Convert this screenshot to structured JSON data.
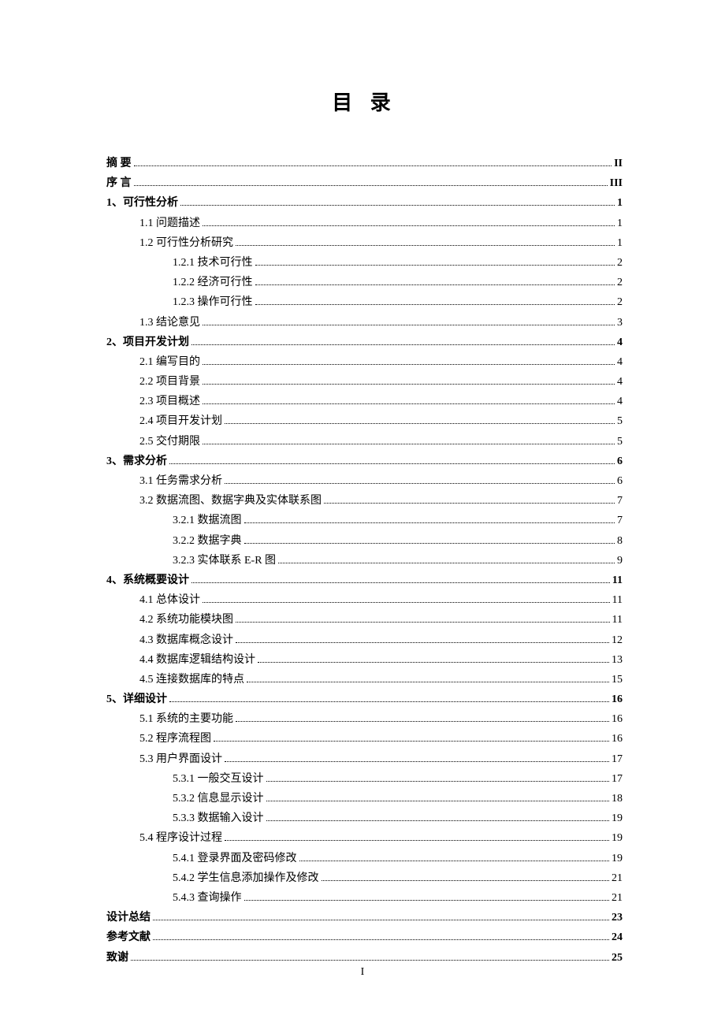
{
  "title": "目 录",
  "pageNumber": "I",
  "entries": [
    {
      "level": 0,
      "label": "摘   要",
      "page": "II"
    },
    {
      "level": 0,
      "label": "序   言",
      "page": "III"
    },
    {
      "level": 0,
      "label": "1、可行性分析",
      "page": "1"
    },
    {
      "level": 1,
      "label": "1.1 问题描述",
      "page": "1"
    },
    {
      "level": 1,
      "label": "1.2 可行性分析研究",
      "page": "1"
    },
    {
      "level": 2,
      "label": "1.2.1 技术可行性",
      "page": "2"
    },
    {
      "level": 2,
      "label": "1.2.2 经济可行性",
      "page": "2"
    },
    {
      "level": 2,
      "label": "1.2.3 操作可行性",
      "page": "2"
    },
    {
      "level": 1,
      "label": "1.3 结论意见",
      "page": "3"
    },
    {
      "level": 0,
      "label": "2、项目开发计划",
      "page": "4"
    },
    {
      "level": 1,
      "label": "2.1 编写目的",
      "page": "4"
    },
    {
      "level": 1,
      "label": "2.2 项目背景",
      "page": "4"
    },
    {
      "level": 1,
      "label": "2.3 项目概述",
      "page": "4"
    },
    {
      "level": 1,
      "label": "2.4 项目开发计划",
      "page": "5"
    },
    {
      "level": 1,
      "label": "2.5 交付期限",
      "page": "5"
    },
    {
      "level": 0,
      "label": "3、需求分析",
      "page": "6"
    },
    {
      "level": 1,
      "label": "3.1 任务需求分析",
      "page": "6"
    },
    {
      "level": 1,
      "label": "3.2 数据流图、数据字典及实体联系图",
      "page": "7"
    },
    {
      "level": 2,
      "label": "3.2.1 数据流图",
      "page": "7"
    },
    {
      "level": 2,
      "label": "3.2.2 数据字典",
      "page": "8"
    },
    {
      "level": 2,
      "label": "3.2.3 实体联系 E-R 图",
      "page": "9"
    },
    {
      "level": 0,
      "label": "4、系统概要设计",
      "page": "11"
    },
    {
      "level": 1,
      "label": "4.1 总体设计",
      "page": "11"
    },
    {
      "level": 1,
      "label": "4.2 系统功能模块图",
      "page": "11"
    },
    {
      "level": 1,
      "label": "4.3 数据库概念设计",
      "page": "12"
    },
    {
      "level": 1,
      "label": "4.4 数据库逻辑结构设计",
      "page": "13"
    },
    {
      "level": 1,
      "label": "4.5 连接数据库的特点",
      "page": "15"
    },
    {
      "level": 0,
      "label": "5、详细设计",
      "page": "16"
    },
    {
      "level": 1,
      "label": "5.1 系统的主要功能",
      "page": "16"
    },
    {
      "level": 1,
      "label": "5.2 程序流程图",
      "page": "16"
    },
    {
      "level": 1,
      "label": "5.3 用户界面设计",
      "page": "17"
    },
    {
      "level": 2,
      "label": "5.3.1 一般交互设计",
      "page": "17"
    },
    {
      "level": 2,
      "label": "5.3.2 信息显示设计",
      "page": "18"
    },
    {
      "level": 2,
      "label": "5.3.3 数据输入设计",
      "page": "19"
    },
    {
      "level": 1,
      "label": "5.4 程序设计过程",
      "page": "19"
    },
    {
      "level": 2,
      "label": "5.4.1 登录界面及密码修改",
      "page": "19"
    },
    {
      "level": 2,
      "label": "5.4.2 学生信息添加操作及修改",
      "page": "21"
    },
    {
      "level": 2,
      "label": "5.4.3 查询操作",
      "page": "21"
    },
    {
      "level": 0,
      "label": "设计总结",
      "page": "23"
    },
    {
      "level": 0,
      "label": "参考文献",
      "page": "24"
    },
    {
      "level": 0,
      "label": "致谢",
      "page": "25"
    }
  ]
}
